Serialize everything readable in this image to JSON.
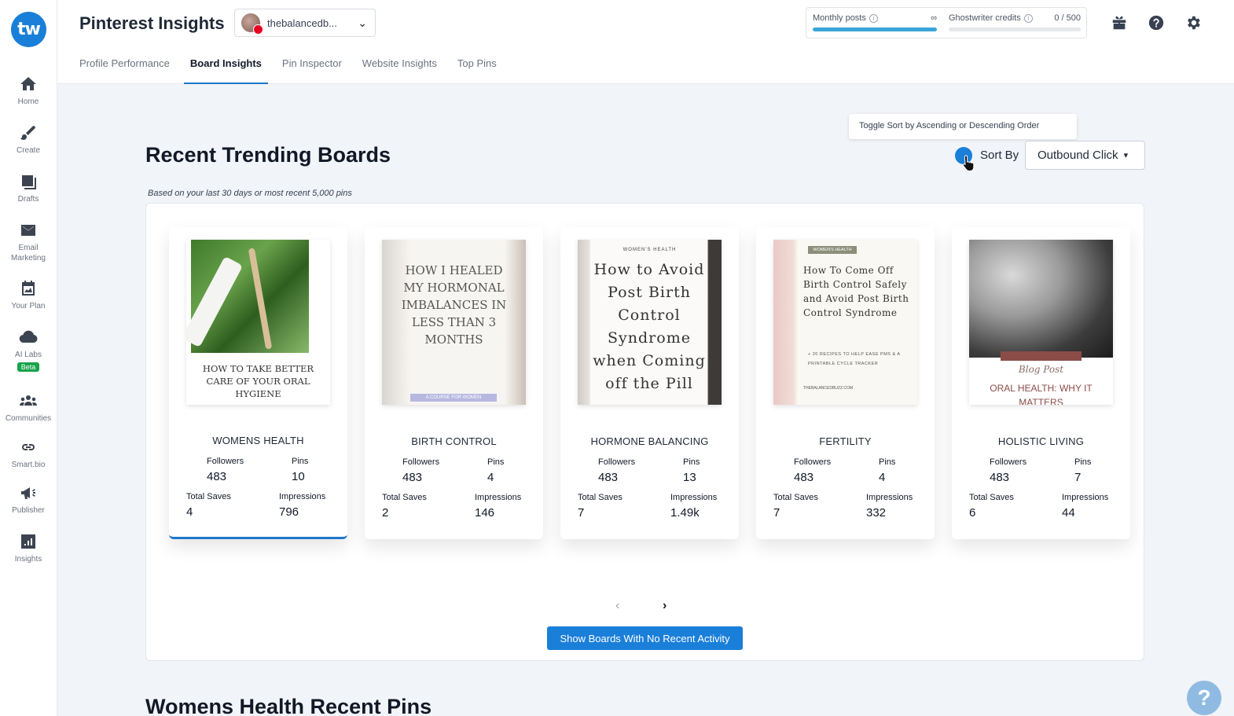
{
  "sidebar": {
    "logo": "tw",
    "items": [
      {
        "label": "Home",
        "icon": "home-icon"
      },
      {
        "label": "Create",
        "icon": "brush-icon"
      },
      {
        "label": "Drafts",
        "icon": "drafts-icon"
      },
      {
        "label": "Email Marketing",
        "icon": "mail-icon"
      },
      {
        "label": "Your Plan",
        "icon": "plan-icon"
      },
      {
        "label": "AI Labs",
        "icon": "cloud-icon",
        "badge": "Beta"
      },
      {
        "label": "Communities",
        "icon": "communities-icon"
      },
      {
        "label": "Smart.bio",
        "icon": "link-icon"
      },
      {
        "label": "Publisher",
        "icon": "megaphone-icon"
      },
      {
        "label": "Insights",
        "icon": "chart-icon"
      }
    ]
  },
  "header": {
    "title": "Pinterest Insights",
    "account_name": "thebalancedb...",
    "monthly_posts_label": "Monthly posts",
    "monthly_posts_value": "∞",
    "monthly_posts_fill": 1.0,
    "ghostwriter_label": "Ghostwriter credits",
    "ghostwriter_value": "0 / 500",
    "ghostwriter_fill": 0.0,
    "tabs": [
      {
        "label": "Profile Performance"
      },
      {
        "label": "Board Insights"
      },
      {
        "label": "Pin Inspector"
      },
      {
        "label": "Website Insights"
      },
      {
        "label": "Top Pins"
      }
    ],
    "active_tab": "Board Insights"
  },
  "main": {
    "section_title": "Recent Trending Boards",
    "section_note": "Based on your last 30 days or most recent 5,000 pins",
    "tooltip": "Toggle Sort by Ascending or Descending Order",
    "sort_label": "Sort By",
    "sort_value": "Outbound Click",
    "stat_labels": {
      "followers": "Followers",
      "pins": "Pins",
      "saves": "Total Saves",
      "impressions": "Impressions"
    },
    "boards": [
      {
        "name": "WOMENS HEALTH",
        "followers": "483",
        "pins": "10",
        "saves": "4",
        "impressions": "796",
        "pin_text": "HOW TO TAKE BETTER CARE OF YOUR ORAL HYGIENE"
      },
      {
        "name": "BIRTH CONTROL",
        "followers": "483",
        "pins": "4",
        "saves": "2",
        "impressions": "146",
        "pin_text": "HOW I HEALED MY HORMONAL IMBALANCES IN LESS THAN 3 MONTHS",
        "pin_sub": "A COURSE FOR WOMEN"
      },
      {
        "name": "HORMONE BALANCING",
        "followers": "483",
        "pins": "13",
        "saves": "7",
        "impressions": "1.49k",
        "pin_tag": "WOMEN'S HEALTH",
        "pin_text": "How to Avoid Post Birth Control Syndrome when Coming off the Pill"
      },
      {
        "name": "FERTILITY",
        "followers": "483",
        "pins": "4",
        "saves": "7",
        "impressions": "332",
        "pin_tag": "WOMEN'S HEALTH",
        "pin_text": "How To Come Off Birth Control Safely and Avoid Post Birth Control Syndrome",
        "pin_sub": "+ 20 RECIPES TO HELP EASE PMS & A PRINTABLE CYCLE TRACKER",
        "pin_url": "THEBALANCEDBUZZ.COM"
      },
      {
        "name": "HOLISTIC LIVING",
        "followers": "483",
        "pins": "7",
        "saves": "6",
        "impressions": "44",
        "pin_script": "Blog Post",
        "pin_text": "ORAL HEALTH: WHY IT MATTERS"
      }
    ],
    "show_button": "Show Boards With No Recent Activity",
    "next_section_title": "Womens Health Recent Pins"
  },
  "colors": {
    "accent": "#1a7fd8",
    "tab_underline": "#1f76c9",
    "beta": "#16a34a"
  }
}
